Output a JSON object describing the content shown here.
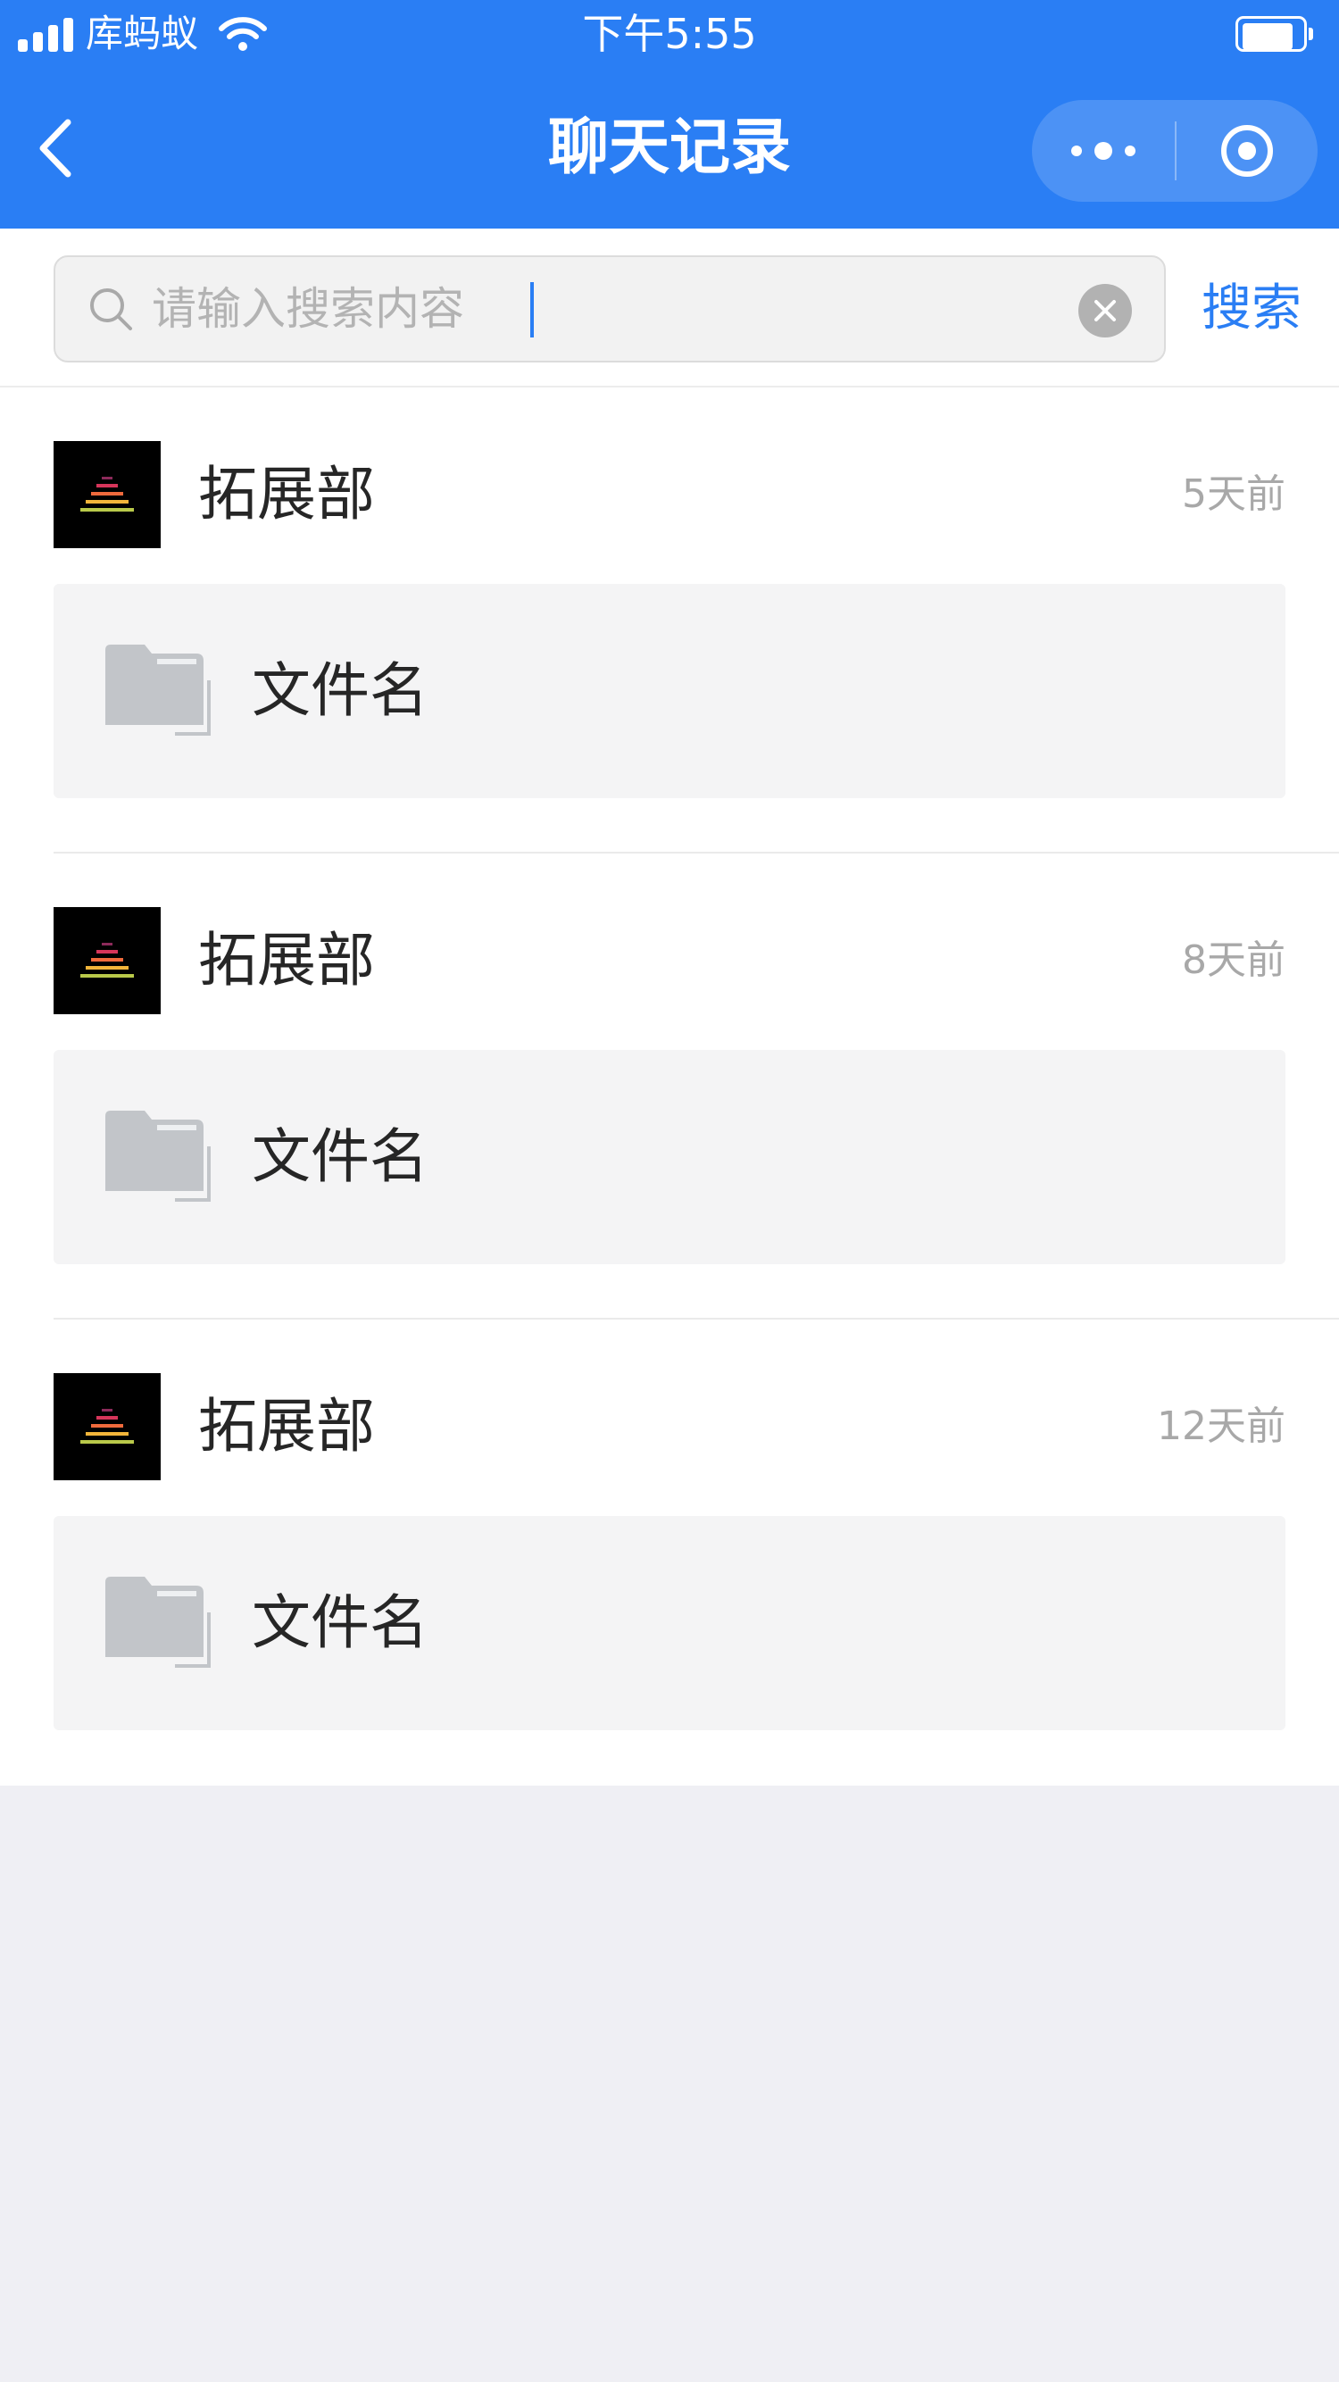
{
  "status_bar": {
    "carrier": "库蚂蚁",
    "time": "下午5:55",
    "battery_level": 0.88
  },
  "nav": {
    "title": "聊天记录"
  },
  "search": {
    "placeholder": "请输入搜索内容",
    "value": "",
    "button_label": "搜索"
  },
  "records": [
    {
      "sender": "拓展部",
      "time": "5天前",
      "file_name": "文件名"
    },
    {
      "sender": "拓展部",
      "time": "8天前",
      "file_name": "文件名"
    },
    {
      "sender": "拓展部",
      "time": "12天前",
      "file_name": "文件名"
    }
  ],
  "colors": {
    "primary": "#2a7ef4",
    "page_background": "#efeff4",
    "card_background": "#f4f4f5",
    "muted_text": "#a8a8a8"
  }
}
